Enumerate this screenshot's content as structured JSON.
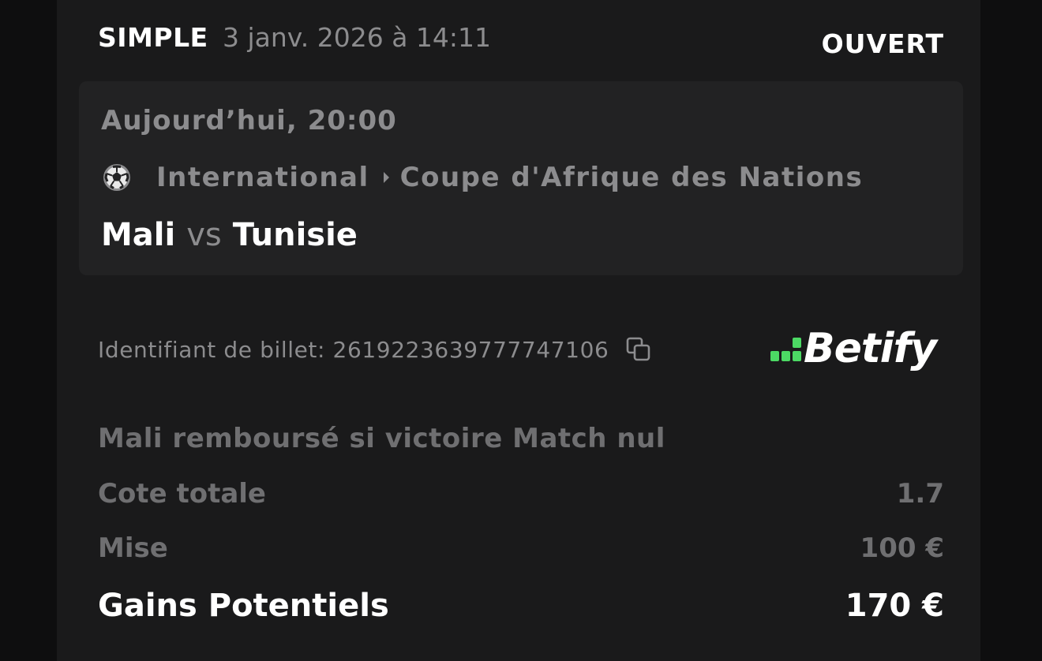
{
  "header": {
    "bet_type": "SIMPLE",
    "date": "3 janv. 2026 à 14:11",
    "status": "OUVERT"
  },
  "event": {
    "time": "Aujourd’hui, 20:00",
    "sport_icon": "soccer-ball-icon",
    "country": "International",
    "league": "Coupe d'Afrique des Nations",
    "home_team": "Mali",
    "vs": "vs",
    "away_team": "Tunisie"
  },
  "ticket": {
    "label": "Identifiant de billet: 2619223639777747106",
    "copy_icon": "copy-icon"
  },
  "brand": {
    "name": "Betify",
    "accent": "#4cd964"
  },
  "selection": "Mali remboursé si victoire Match nul",
  "summary": {
    "odds_label": "Cote totale",
    "odds_value": "1.7",
    "stake_label": "Mise",
    "stake_value": "100 €",
    "gains_label": "Gains Potentiels",
    "gains_value": "170 €"
  }
}
